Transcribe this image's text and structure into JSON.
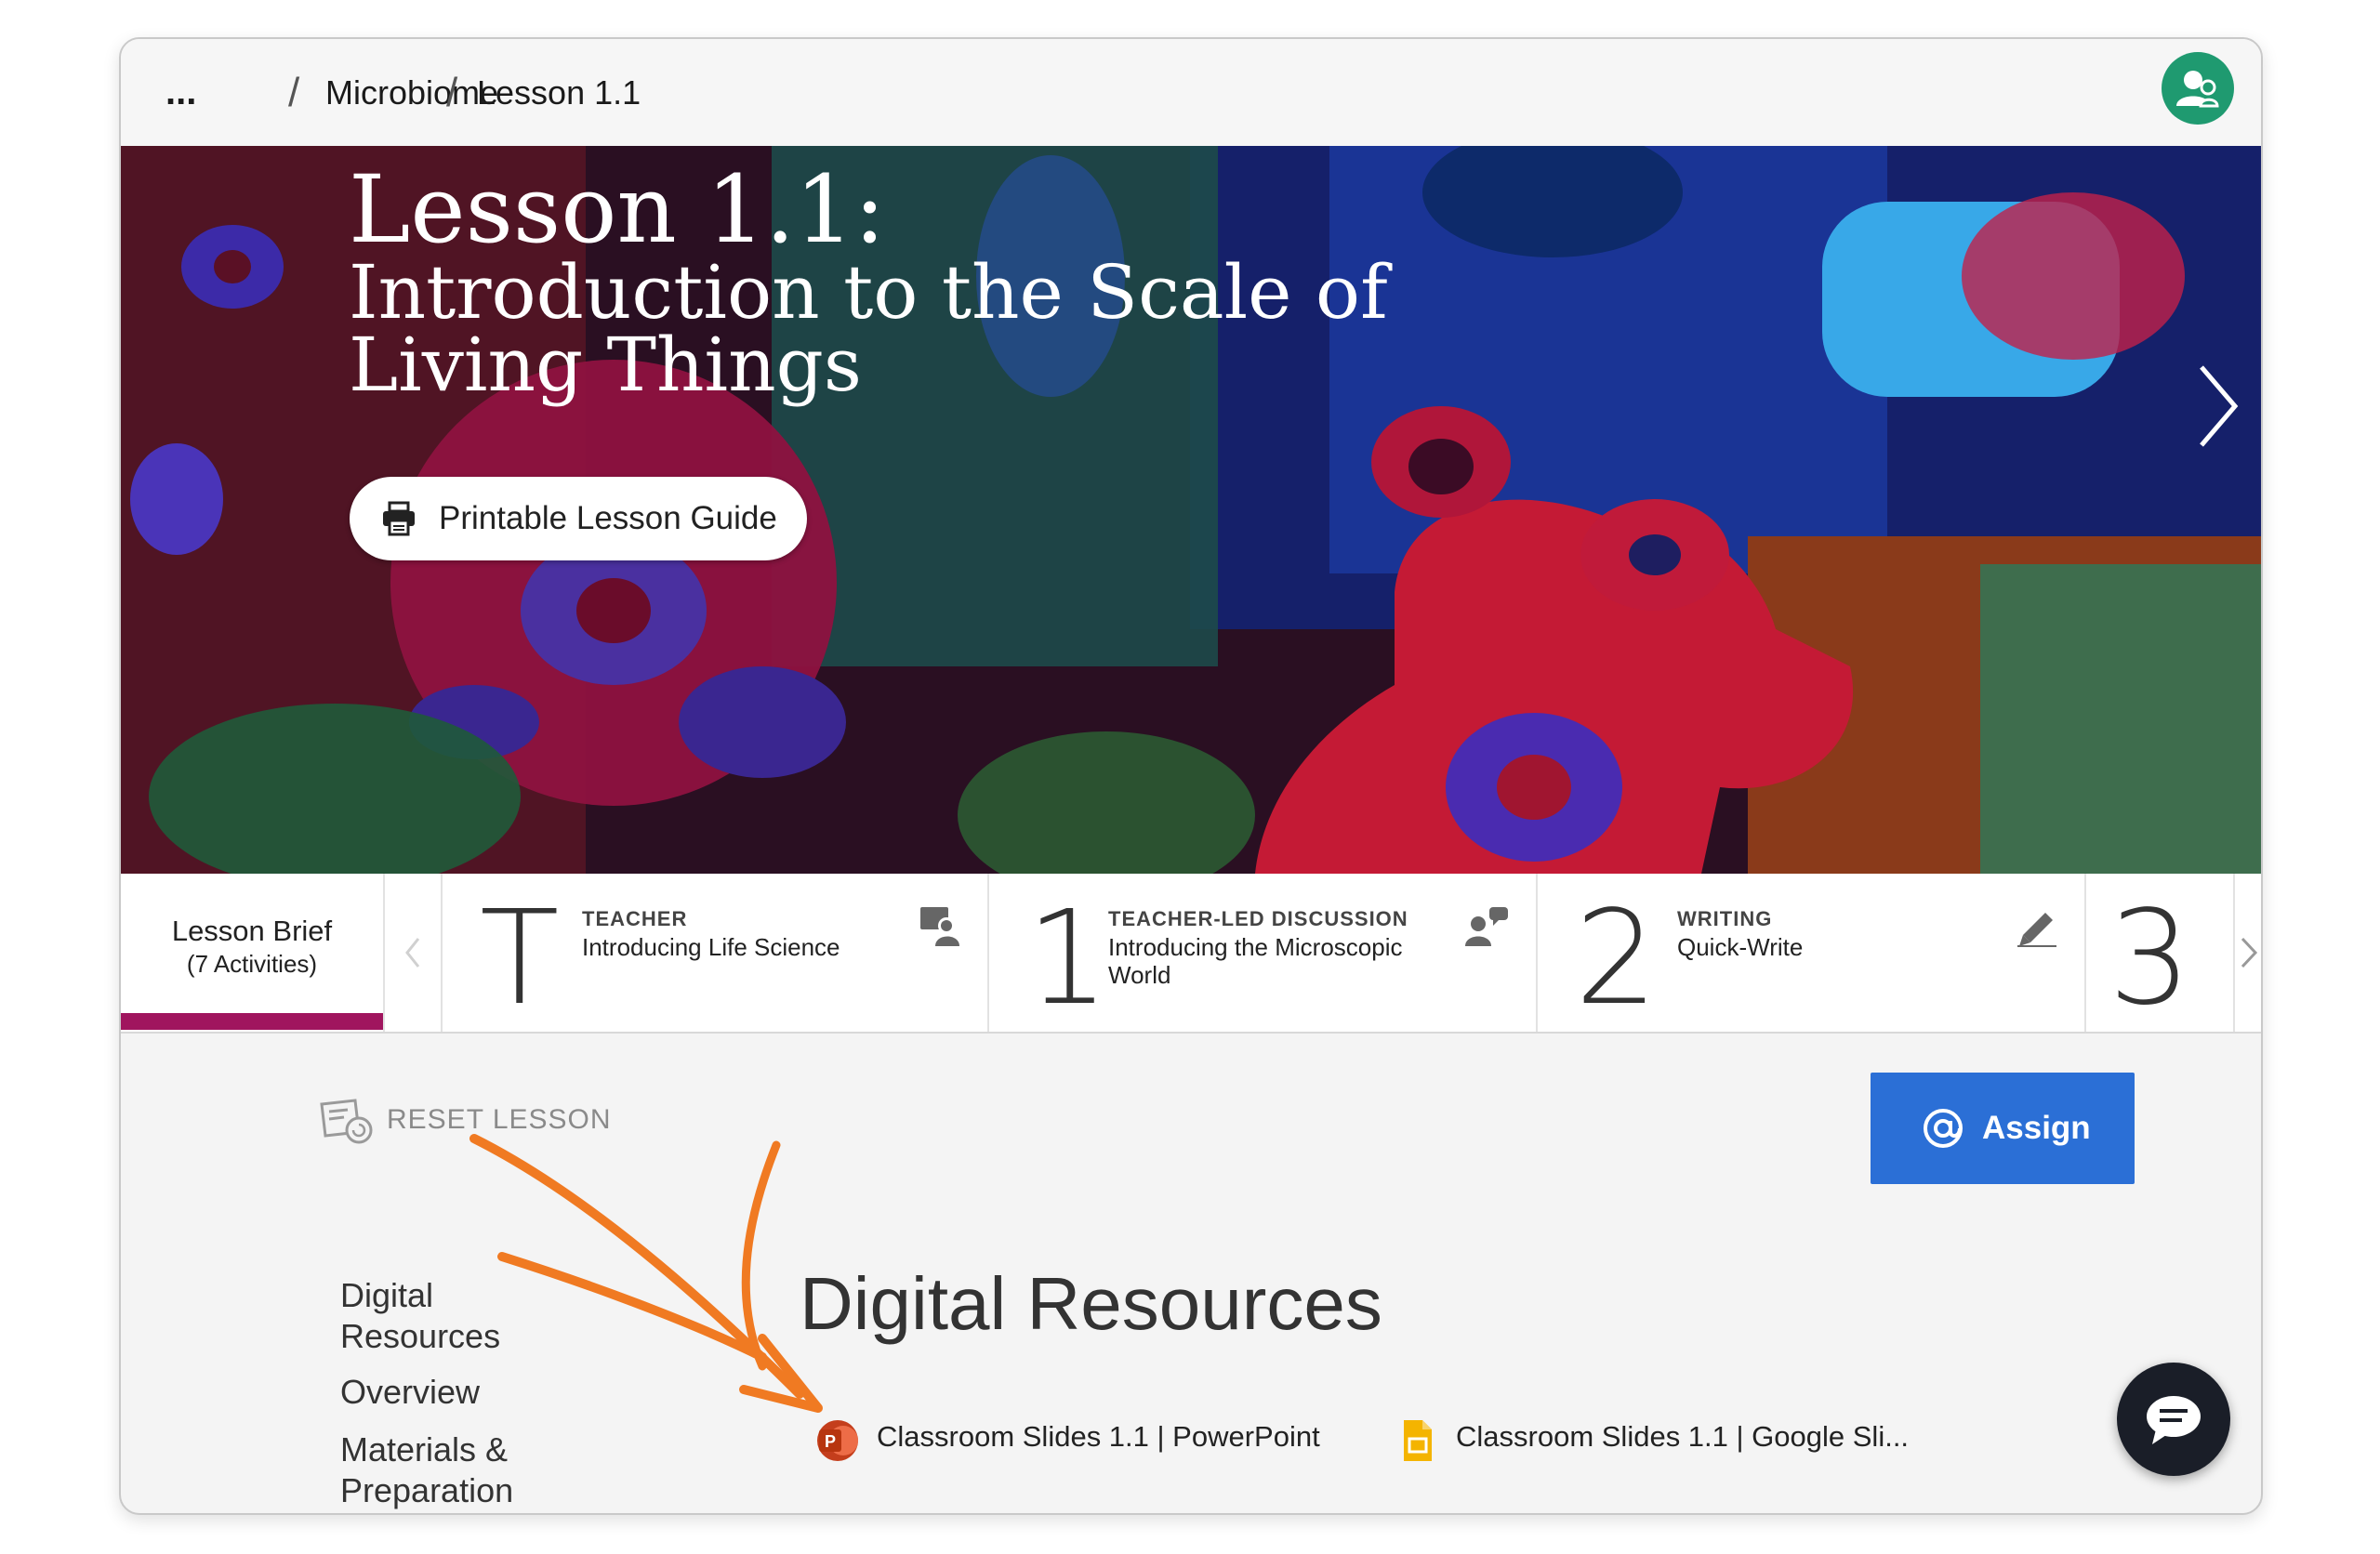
{
  "breadcrumb": {
    "more": "...",
    "items": [
      "Microbiome",
      "Lesson 1.1"
    ]
  },
  "hero": {
    "title_line1": "Lesson 1.1:",
    "title_line2": "Introduction to the Scale of",
    "title_line3": "Living Things",
    "print_button": "Printable Lesson Guide"
  },
  "tabs": {
    "brief_title": "Lesson Brief",
    "brief_count": "(7 Activities)",
    "activities": [
      {
        "num": "T",
        "kind": "TEACHER",
        "name": "Introducing Life Science",
        "icon": "teacher-presentation-icon"
      },
      {
        "num": "1",
        "kind": "TEACHER-LED DISCUSSION",
        "name": "Introducing the Microscopic World",
        "icon": "discussion-icon"
      },
      {
        "num": "2",
        "kind": "WRITING",
        "name": "Quick-Write",
        "icon": "pencil-icon"
      },
      {
        "num": "3",
        "kind": "",
        "name": "",
        "icon": ""
      }
    ]
  },
  "content": {
    "reset_label": "RESET LESSON",
    "assign_label": "Assign",
    "sidenav": [
      "Digital",
      "Resources",
      "Overview",
      "Materials &",
      "Preparation"
    ],
    "section_title": "Digital Resources",
    "resources": [
      {
        "label": "Classroom Slides 1.1 | PowerPoint",
        "icon": "powerpoint-icon"
      },
      {
        "label": "Classroom Slides 1.1 | Google Sli...",
        "icon": "google-slides-icon"
      }
    ]
  },
  "colors": {
    "accent_tab": "#a0155e",
    "assign_button": "#2b6fd6",
    "avatar": "#1f9a70",
    "annotation_arrow": "#f07a22"
  }
}
